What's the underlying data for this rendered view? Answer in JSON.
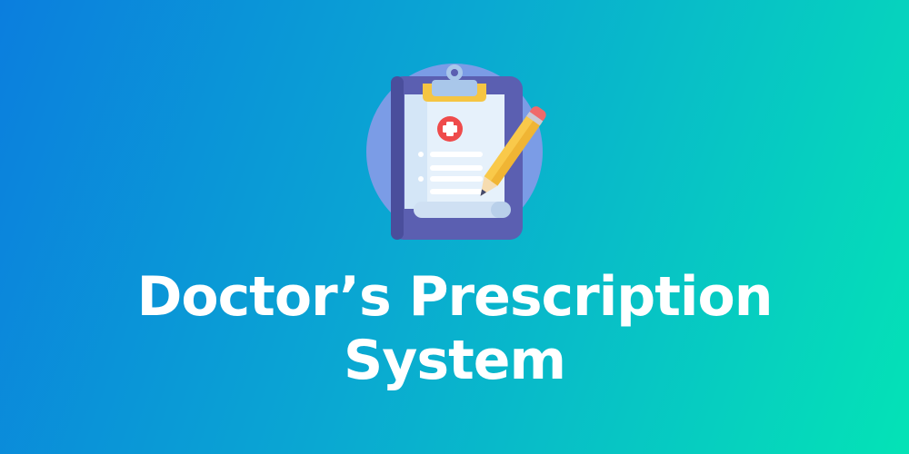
{
  "banner": {
    "title_line1": "Doctor’s Prescription",
    "title_line2": "System",
    "icon": "clipboard-prescription-icon",
    "colors": {
      "gradient_start": "#0b7ede",
      "gradient_end": "#04e3b6",
      "circle": "#7b9ce6",
      "board": "#5b5fb1",
      "paper": "#e6f1fb",
      "clip": "#f5c542",
      "cross": "#ef4b4b",
      "pencil": "#f9c94a"
    }
  }
}
